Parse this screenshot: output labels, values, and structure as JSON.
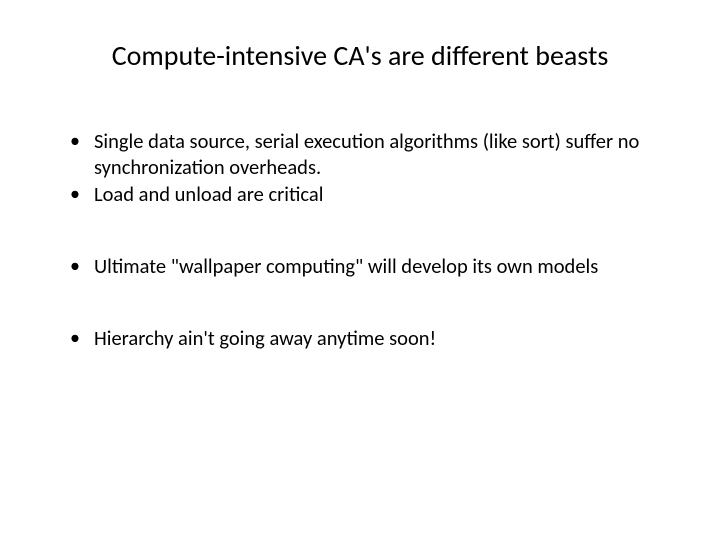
{
  "slide": {
    "title": "Compute-intensive CA's are different beasts",
    "bullets": [
      "Single data source, serial execution algorithms (like sort) suffer no synchronization overheads.",
      "Load and unload are critical",
      "Ultimate \"wallpaper computing\" will develop its own models",
      "Hierarchy ain't going away anytime soon!"
    ]
  }
}
